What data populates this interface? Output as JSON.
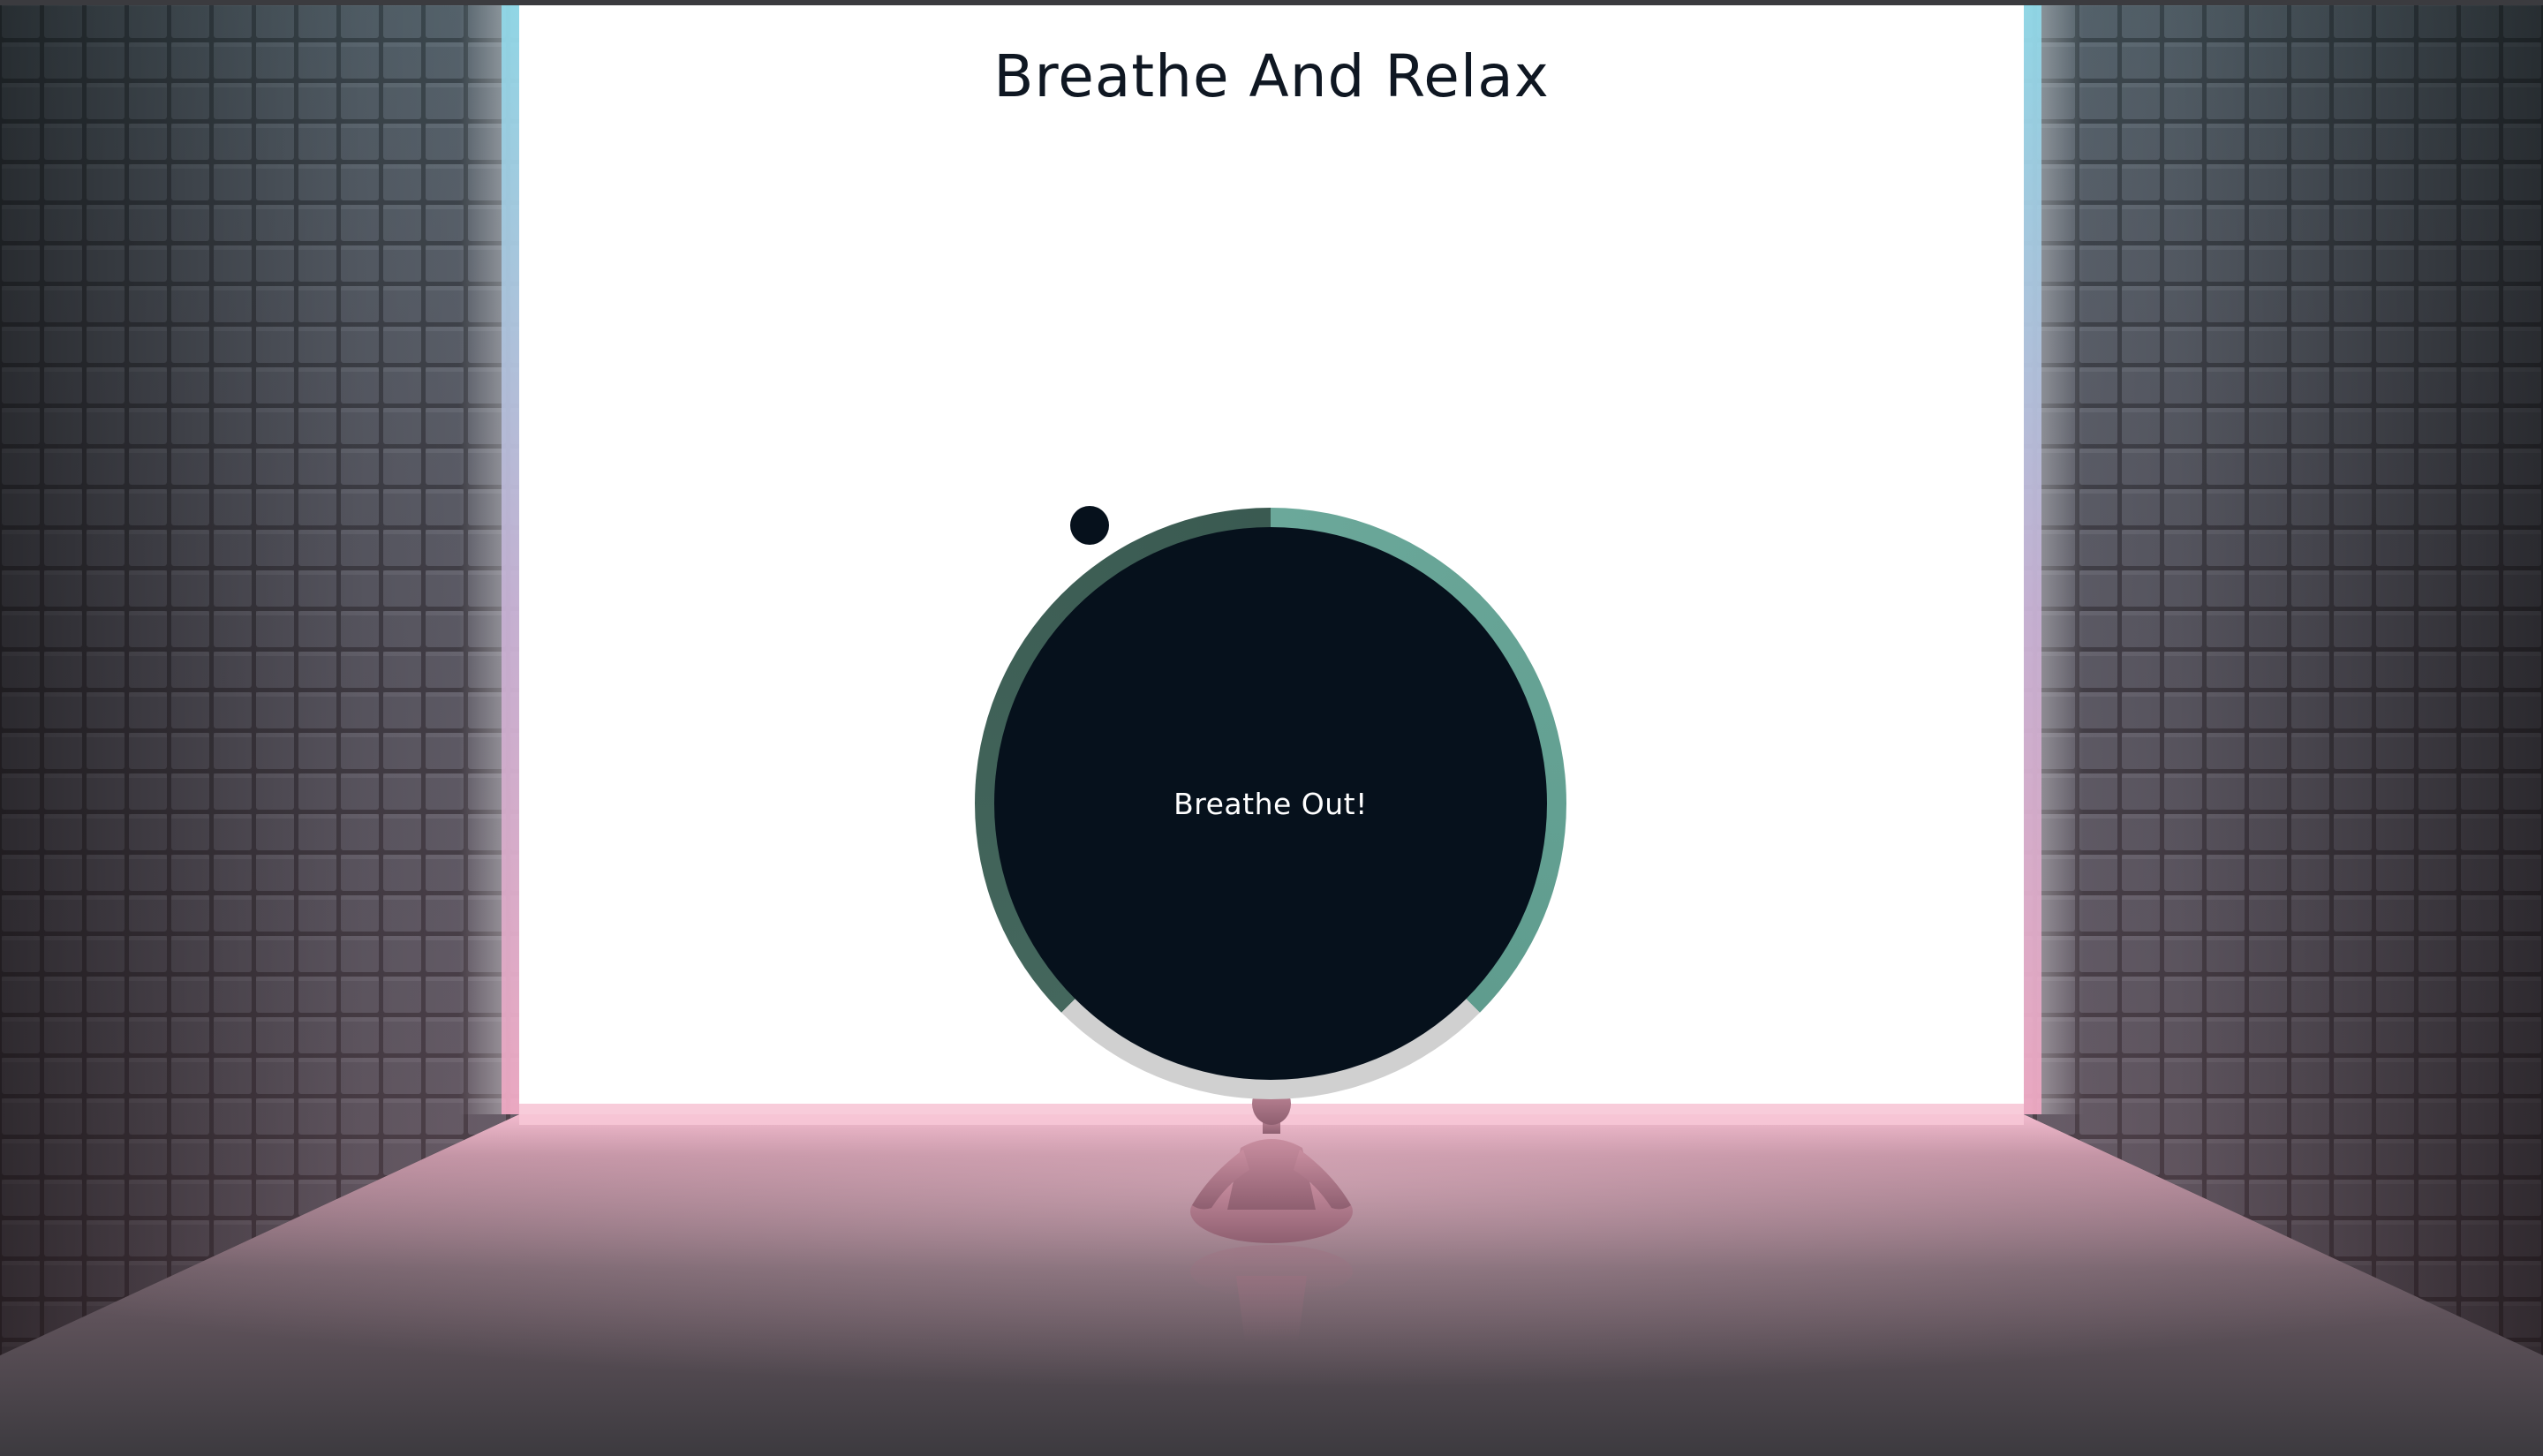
{
  "page": {
    "title": "Breathe And Relax"
  },
  "breath": {
    "status_text": "Breathe Out!",
    "ring_colors": {
      "breathe_in": "#6ba89a",
      "hold": "#d0d0d0",
      "breathe_out": "#3a5a51"
    },
    "core_color": "#06111c"
  },
  "scene": {
    "background_icon": "meditating-figure-icon",
    "glow_colors": {
      "top": "#8fdcec",
      "bottom": "#f2a9c4"
    }
  }
}
